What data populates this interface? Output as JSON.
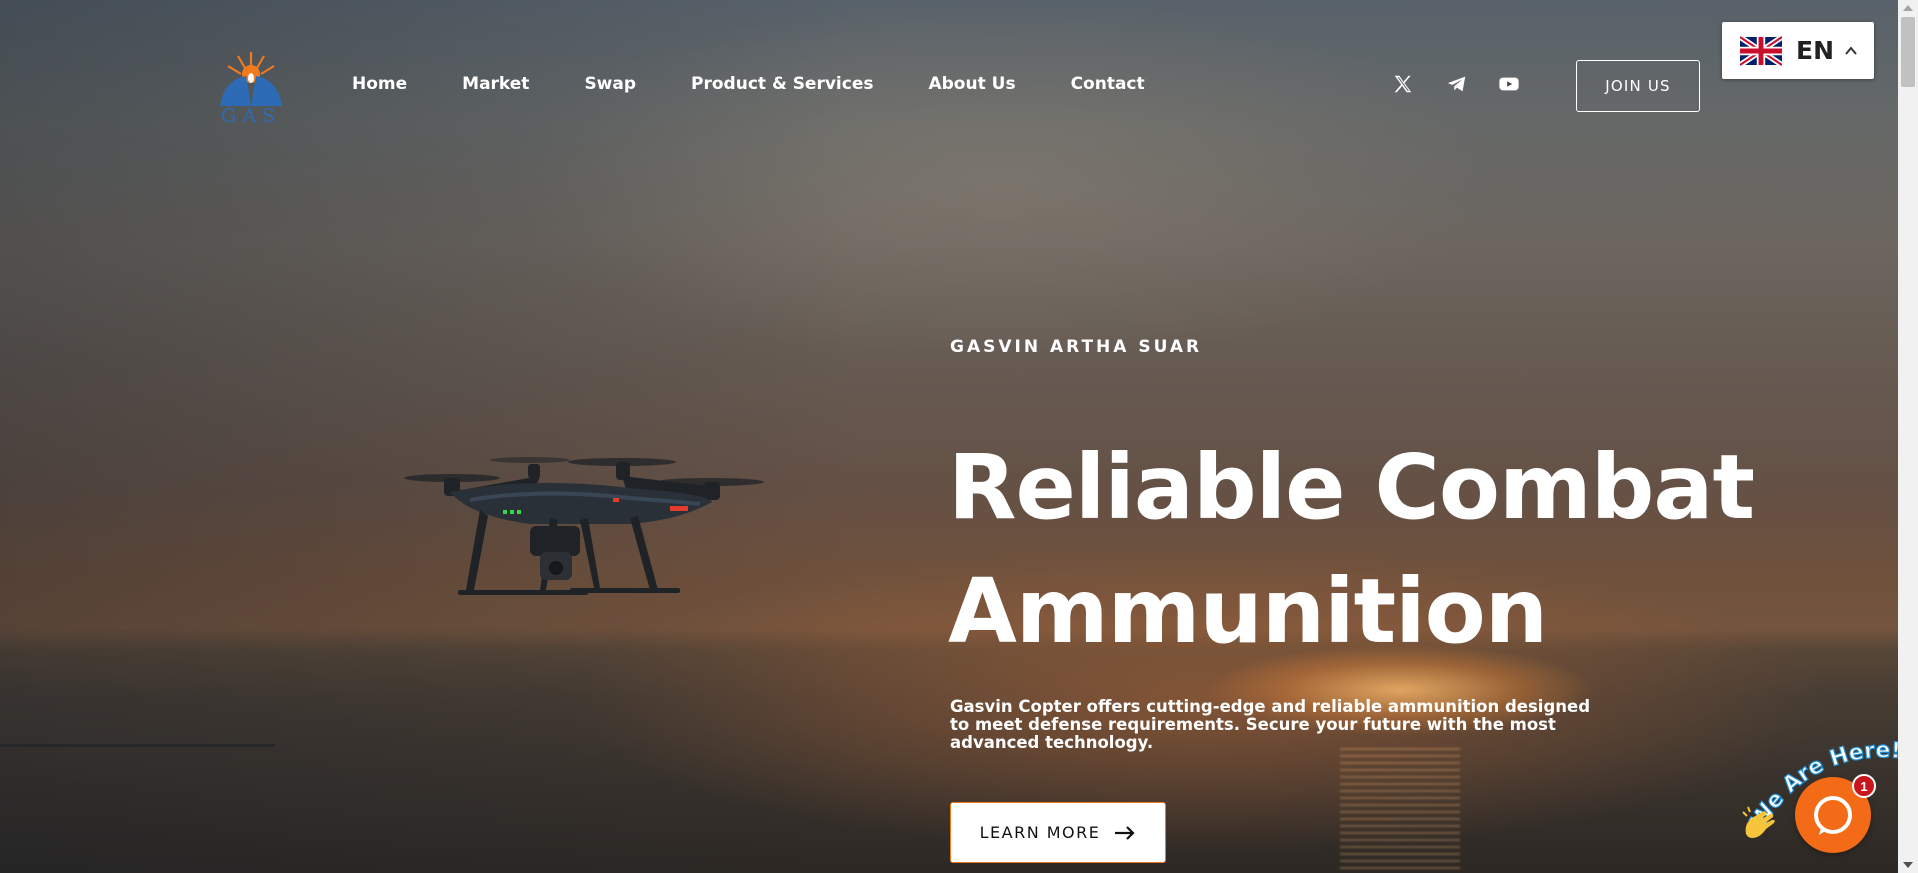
{
  "brand": {
    "logo_text": "GAS"
  },
  "nav": {
    "items": [
      {
        "label": "Home"
      },
      {
        "label": "Market"
      },
      {
        "label": "Swap"
      },
      {
        "label": "Product & Services"
      },
      {
        "label": "About Us"
      },
      {
        "label": "Contact"
      }
    ]
  },
  "social": {
    "icons": [
      "x-icon",
      "telegram-icon",
      "youtube-icon"
    ]
  },
  "header": {
    "join_label": "JOIN US"
  },
  "language": {
    "code": "EN",
    "flag": "uk-flag-icon"
  },
  "hero": {
    "eyebrow": "GASVIN ARTHA SUAR",
    "headline_line1": "Reliable Combat",
    "headline_line2": "Ammunition",
    "description": "Gasvin Copter offers cutting-edge and reliable ammunition designed to meet defense requirements. Secure your future with the most advanced technology.",
    "cta_label": "LEARN MORE"
  },
  "chat": {
    "tagline": "We Are Here!",
    "badge_count": "1",
    "accent": "#f36a17"
  },
  "colors": {
    "logo_blue": "#2e6bb6",
    "logo_orange": "#f07a1e",
    "cta_border": "#f07a1e",
    "badge_red": "#c8161d"
  }
}
